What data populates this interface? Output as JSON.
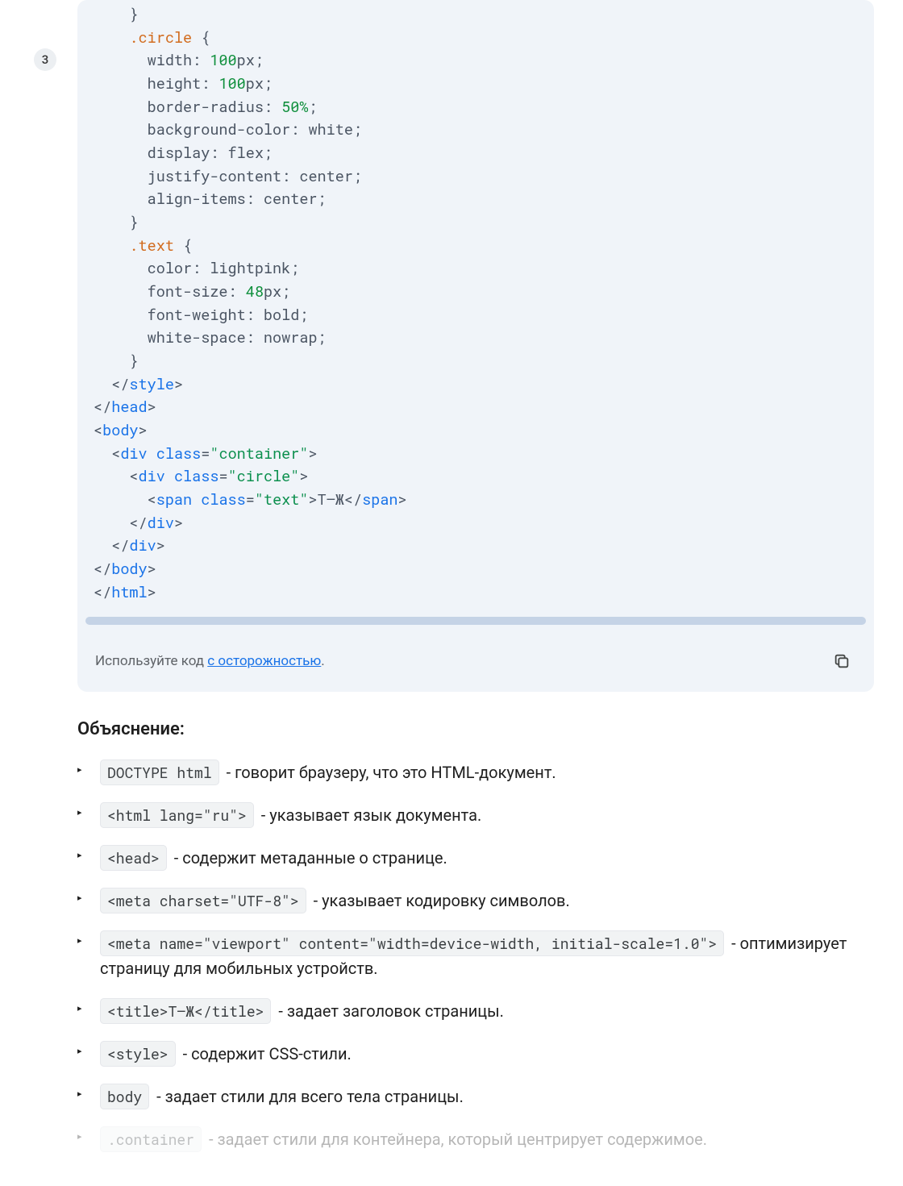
{
  "badge": {
    "label": "3"
  },
  "code": {
    "lines": [
      {
        "t": "plain",
        "text": "    }"
      },
      {
        "t": "sel",
        "text": "    .circle {",
        "sel": ".circle"
      },
      {
        "t": "propnum",
        "text": "      width: ",
        "val": "100",
        "unit": "px",
        "tail": ";"
      },
      {
        "t": "propnum",
        "text": "      height: ",
        "val": "100",
        "unit": "px",
        "tail": ";"
      },
      {
        "t": "proppct",
        "text": "      border-radius: ",
        "val": "50%",
        "tail": ";"
      },
      {
        "t": "plain",
        "text": "      background-color: white;"
      },
      {
        "t": "plain",
        "text": "      display: flex;"
      },
      {
        "t": "plain",
        "text": "      justify-content: center;"
      },
      {
        "t": "plain",
        "text": "      align-items: center;"
      },
      {
        "t": "plain",
        "text": "    }"
      },
      {
        "t": "sel",
        "text": "    .text {",
        "sel": ".text"
      },
      {
        "t": "plain",
        "text": "      color: lightpink;"
      },
      {
        "t": "propnum",
        "text": "      font-size: ",
        "val": "48",
        "unit": "px",
        "tail": ";"
      },
      {
        "t": "plain",
        "text": "      font-weight: bold;"
      },
      {
        "t": "plain",
        "text": "      white-space: nowrap;"
      },
      {
        "t": "plain",
        "text": "    }"
      },
      {
        "t": "closetag",
        "text": "  </",
        "tag": "style",
        "tail": ">"
      },
      {
        "t": "closetag",
        "text": "</",
        "tag": "head",
        "tail": ">"
      },
      {
        "t": "opentag",
        "text": "<",
        "tag": "body",
        "tail": ">"
      },
      {
        "t": "tagattr",
        "text": "  <",
        "tag": "div",
        "mid": " ",
        "attr": "class",
        "eq": "=",
        "str": "\"container\"",
        "tail": ">"
      },
      {
        "t": "tagattr",
        "text": "    <",
        "tag": "div",
        "mid": " ",
        "attr": "class",
        "eq": "=",
        "str": "\"circle\"",
        "tail": ">"
      },
      {
        "t": "tagattr",
        "text": "      <",
        "tag": "span",
        "mid": " ",
        "attr": "class",
        "eq": "=",
        "str": "\"text\"",
        "tail": ">Т—Ж</",
        "tag2": "span",
        "tail2": ">"
      },
      {
        "t": "closetag",
        "text": "    </",
        "tag": "div",
        "tail": ">"
      },
      {
        "t": "closetag",
        "text": "  </",
        "tag": "div",
        "tail": ">"
      },
      {
        "t": "closetag",
        "text": "</",
        "tag": "body",
        "tail": ">"
      },
      {
        "t": "closetag",
        "text": "</",
        "tag": "html",
        "tail": ">"
      }
    ]
  },
  "footer": {
    "prefix": "Используйте код ",
    "link": "с осторожностью",
    "suffix": "."
  },
  "explanation": {
    "heading": "Объяснение:",
    "items": [
      {
        "code": "DOCTYPE html",
        "text": " - говорит браузеру, что это HTML-документ."
      },
      {
        "code": "<html lang=\"ru\">",
        "text": " - указывает язык документа."
      },
      {
        "code": "<head>",
        "text": " - содержит метаданные о странице."
      },
      {
        "code": "<meta charset=\"UTF-8\">",
        "text": " - указывает кодировку символов."
      },
      {
        "code": "<meta name=\"viewport\" content=\"width=device-width, initial-scale=1.0\">",
        "text": " - оптимизирует страницу для мобильных устройств."
      },
      {
        "code": "<title>Т—Ж</title>",
        "text": " - задает заголовок страницы."
      },
      {
        "code": "<style>",
        "text": " - содержит CSS-стили."
      },
      {
        "code": "body",
        "text": " - задает стили для всего тела страницы."
      },
      {
        "code": ".container",
        "text": " - задает стили для контейнера, который центрирует содержимое.",
        "faded": true
      }
    ]
  }
}
